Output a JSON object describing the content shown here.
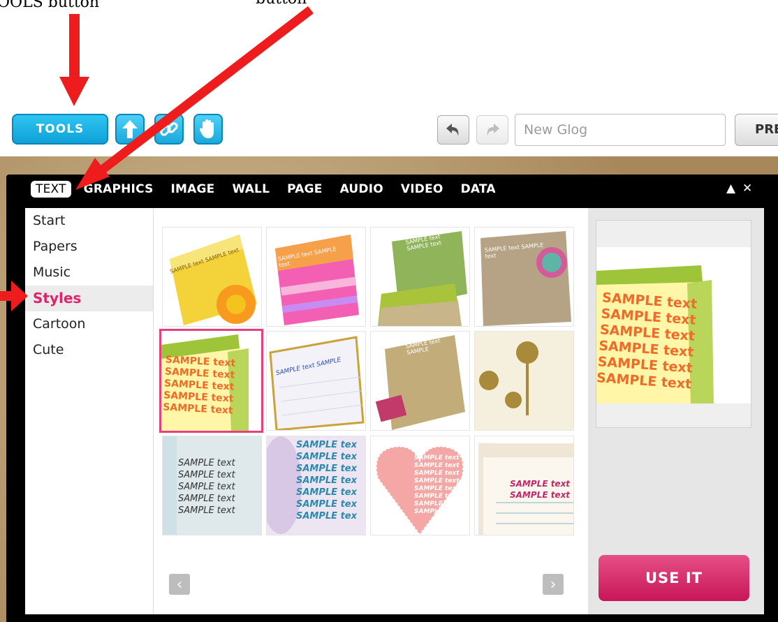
{
  "annotations": {
    "tools_label": "OOLS button",
    "button_label": "button"
  },
  "toolbar": {
    "tools_label": "TOOLS",
    "upload_icon": "arrow-up-icon",
    "link_icon": "link-icon",
    "hand_icon": "hand-icon",
    "undo_icon": "undo-icon",
    "redo_icon": "redo-icon",
    "glog_placeholder": "New Glog",
    "preview_label": "PRE"
  },
  "tabs": [
    "TEXT",
    "GRAPHICS",
    "IMAGE",
    "WALL",
    "PAGE",
    "AUDIO",
    "VIDEO",
    "DATA"
  ],
  "window_controls": {
    "collapse": "▲",
    "close": "✕"
  },
  "sidebar": {
    "items": [
      "Start",
      "Papers",
      "Music",
      "Styles",
      "Cartoon",
      "Cute"
    ],
    "active": "Styles"
  },
  "thumbnails": [
    {
      "text": "SAMPLE text SAMPLE text"
    },
    {
      "text": "SAMPLE text SAMPLE text"
    },
    {
      "text": "SAMPLE text SAMPLE text"
    },
    {
      "text": "SAMPLE text SAMPLE text"
    },
    {
      "text": "SAMPLE text"
    },
    {
      "text": "SAMPLE text SAMPLE"
    },
    {
      "text": "SAMPLE text SAMPLE"
    },
    {
      "text": ""
    },
    {
      "text": "SAMPLE text"
    },
    {
      "text": "SAMPLE tex"
    },
    {
      "text": "SAMPLE text"
    },
    {
      "text": "SAMPLE text"
    }
  ],
  "use_button": "USE IT",
  "colors": {
    "tools_blue": "#1ab0e4",
    "accent_pink": "#e0246a",
    "arrow_red": "#ee1c1c"
  }
}
